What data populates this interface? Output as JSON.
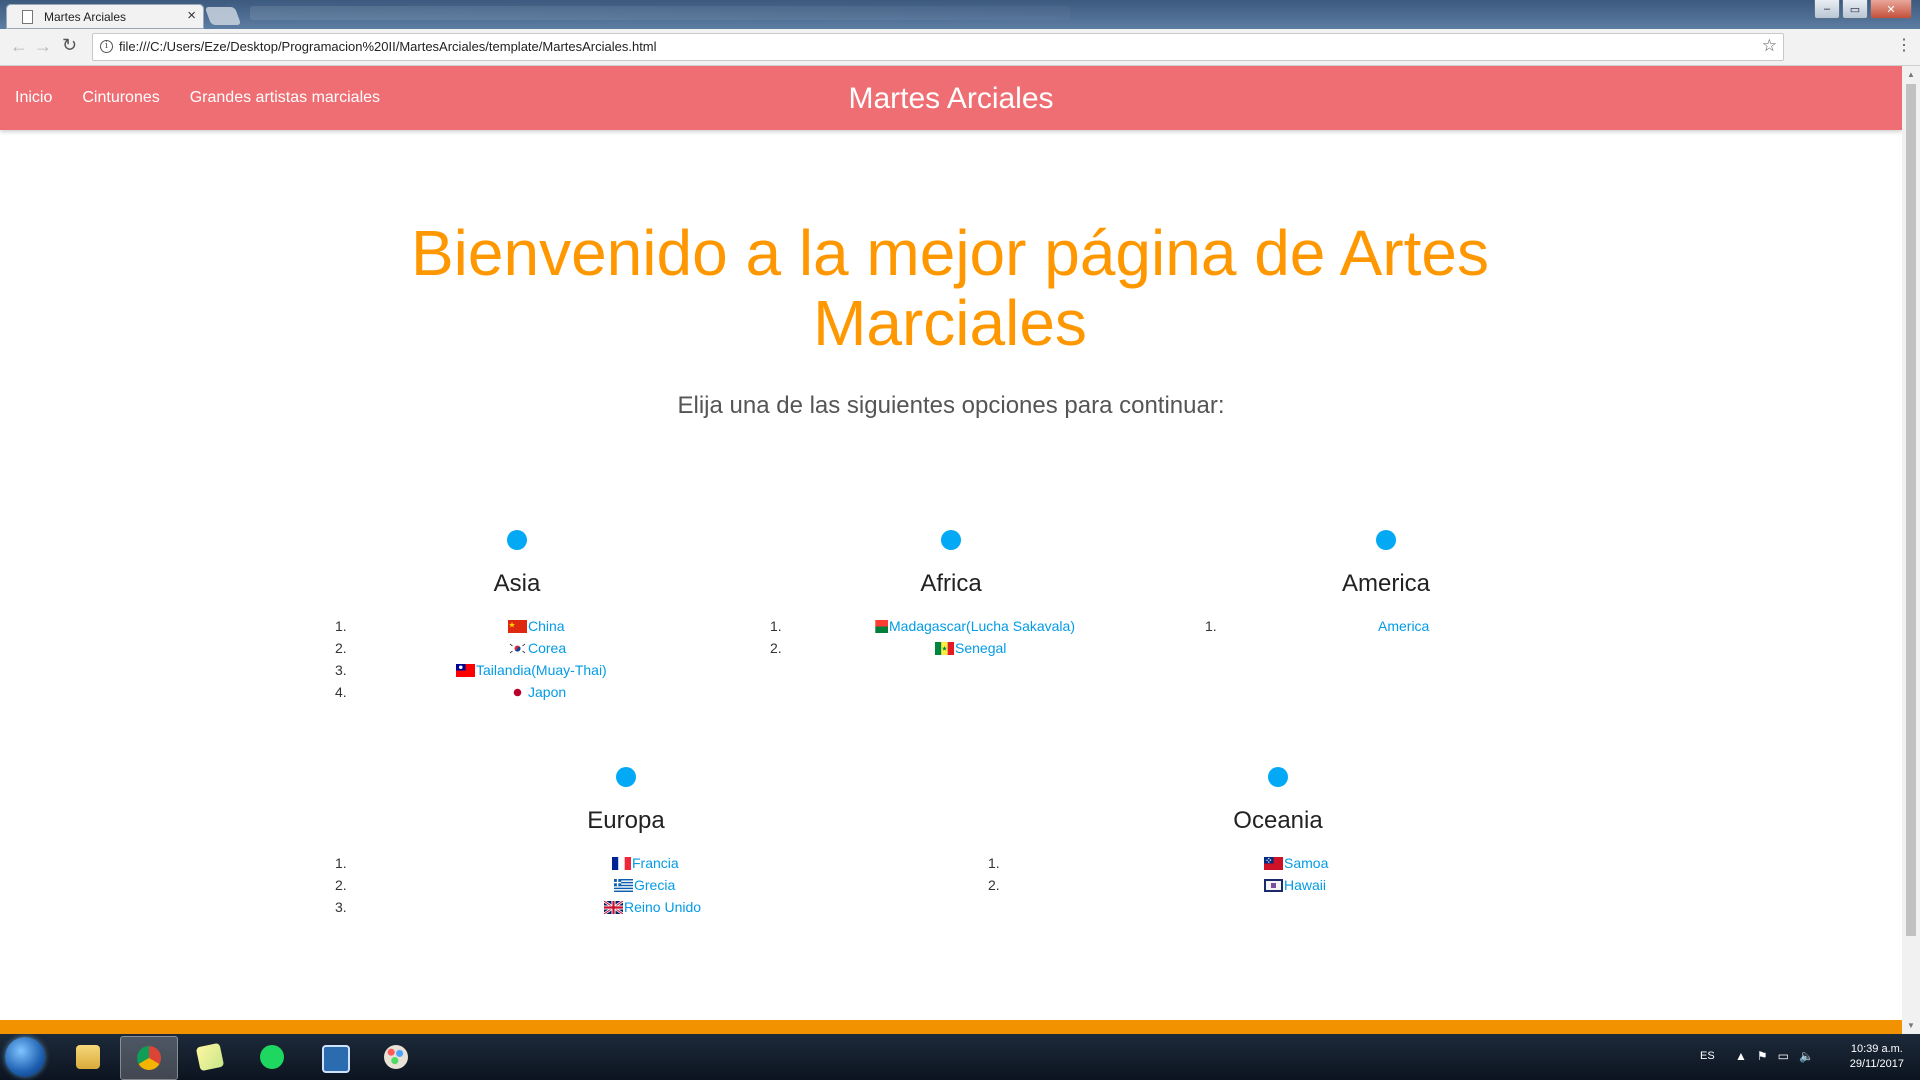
{
  "browser": {
    "tab_title": "Martes Arciales",
    "tab_close": "×",
    "url": "file:///C:/Users/Eze/Desktop/Programacion%20II/MartesArciales/template/MartesArciales.html",
    "back_icon": "←",
    "forward_icon": "→",
    "reload_icon": "↻",
    "star_icon": "☆",
    "menu_icon": "⋮",
    "window_buttons": [
      "–",
      "▭",
      "✕"
    ]
  },
  "site": {
    "nav_links": [
      "Inicio",
      "Cinturones",
      "Grandes artistas marciales"
    ],
    "brand": "Martes Arciales",
    "hero_title": "Bienvenido a la mejor página de Artes Marciales",
    "subtitle": "Elija una de las siguientes opciones para continuar:"
  },
  "regions": [
    {
      "name": "Asia",
      "items": [
        {
          "num": "1.",
          "label": "China",
          "flag": "china"
        },
        {
          "num": "2.",
          "label": "Corea",
          "flag": "korea"
        },
        {
          "num": "3.",
          "label": "Tailandia(Muay-Thai)",
          "flag": "taiwan"
        },
        {
          "num": "4.",
          "label": "Japon",
          "flag": "japan"
        }
      ]
    },
    {
      "name": "Africa",
      "items": [
        {
          "num": "1.",
          "label": "Madagascar(Lucha Sakavala)",
          "flag": "madagascar"
        },
        {
          "num": "2.",
          "label": "Senegal",
          "flag": "senegal"
        }
      ]
    },
    {
      "name": "America",
      "items": [
        {
          "num": "1.",
          "label": "America",
          "flag": "none"
        }
      ]
    },
    {
      "name": "Europa",
      "items": [
        {
          "num": "1.",
          "label": "Francia",
          "flag": "france"
        },
        {
          "num": "2.",
          "label": "Grecia",
          "flag": "greece"
        },
        {
          "num": "3.",
          "label": "Reino Unido",
          "flag": "uk"
        }
      ]
    },
    {
      "name": "Oceania",
      "items": [
        {
          "num": "1.",
          "label": "Samoa",
          "flag": "samoa"
        },
        {
          "num": "2.",
          "label": "Hawaii",
          "flag": "hawaii"
        }
      ]
    }
  ],
  "taskbar": {
    "language": "ES",
    "time": "10:39 a.m.",
    "date": "29/11/2017",
    "tray_icons": [
      "▲",
      "⚑",
      "▭",
      "🔈"
    ]
  },
  "colors": {
    "nav_bg": "#ef6e73",
    "hero": "#ff9800",
    "dot": "#03a9f4",
    "link": "#039be5",
    "footer": "#f39200"
  }
}
